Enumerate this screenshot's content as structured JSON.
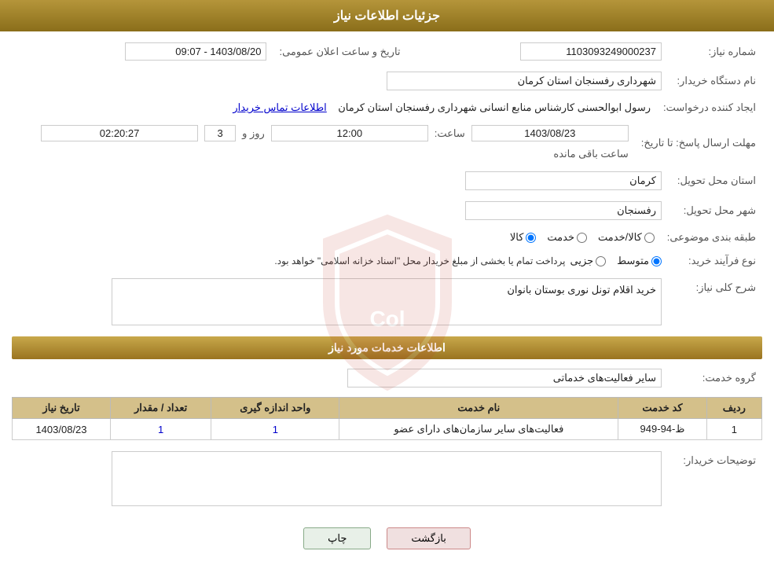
{
  "header": {
    "title": "جزئیات اطلاعات نیاز"
  },
  "fields": {
    "need_number_label": "شماره نیاز:",
    "need_number_value": "1103093249000237",
    "announce_date_label": "تاریخ و ساعت اعلان عمومی:",
    "announce_date_value": "1403/08/20 - 09:07",
    "org_name_label": "نام دستگاه خریدار:",
    "org_name_value": "شهرداری رفسنجان استان کرمان",
    "creator_label": "ایجاد کننده درخواست:",
    "creator_value": "رسول ابوالحسنی کارشناس منابع انسانی شهرداری رفسنجان استان کرمان",
    "creator_link": "اطلاعات تماس خریدار",
    "deadline_label": "مهلت ارسال پاسخ: تا تاریخ:",
    "deadline_date": "1403/08/23",
    "deadline_time_label": "ساعت:",
    "deadline_time": "12:00",
    "deadline_day_label": "روز و",
    "deadline_days": "3",
    "deadline_remaining_label": "ساعت باقی مانده",
    "deadline_remaining": "02:20:27",
    "province_label": "استان محل تحویل:",
    "province_value": "کرمان",
    "city_label": "شهر محل تحویل:",
    "city_value": "رفسنجان",
    "category_label": "طبقه بندی موضوعی:",
    "category_options": [
      "کالا",
      "خدمت",
      "کالا/خدمت"
    ],
    "category_selected": "کالا",
    "purchase_type_label": "نوع فرآیند خرید:",
    "purchase_type_options": [
      "جزیی",
      "متوسط"
    ],
    "purchase_type_selected": "متوسط",
    "purchase_notice": "پرداخت تمام یا بخشی از مبلغ خریدار محل \"اسناد خزانه اسلامی\" خواهد بود.",
    "need_desc_label": "شرح کلی نیاز:",
    "need_desc_value": "خرید اقلام تونل نوری بوستان بانوان",
    "services_section_title": "اطلاعات خدمات مورد نیاز",
    "service_group_label": "گروه خدمت:",
    "service_group_value": "سایر فعالیت‌های خدماتی",
    "table": {
      "headers": [
        "ردیف",
        "کد خدمت",
        "نام خدمت",
        "واحد اندازه گیری",
        "تعداد / مقدار",
        "تاریخ نیاز"
      ],
      "rows": [
        {
          "row": "1",
          "code": "ظ-94-949",
          "name": "فعالیت‌های سایر سازمان‌های دارای عضو",
          "unit": "1",
          "quantity": "1",
          "date": "1403/08/23"
        }
      ]
    },
    "buyer_desc_label": "توضیحات خریدار:",
    "buyer_desc_value": ""
  },
  "buttons": {
    "back_label": "بازگشت",
    "print_label": "چاپ"
  },
  "watermark_text": "Col"
}
